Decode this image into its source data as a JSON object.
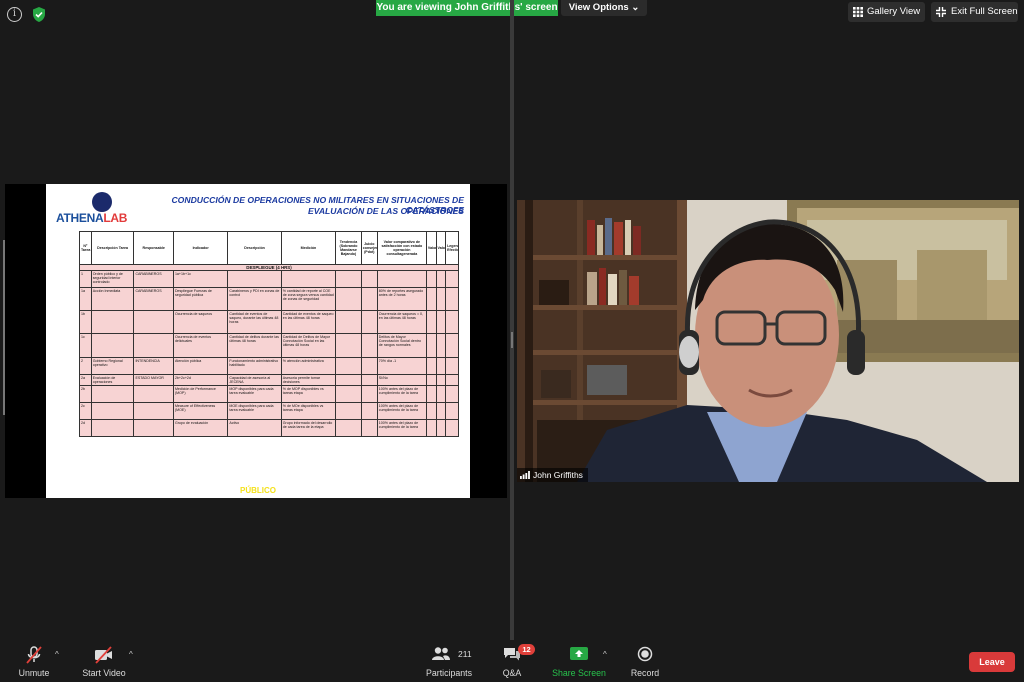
{
  "top_bar": {
    "info_icon": "info-icon",
    "security_icon": "shield-check-icon",
    "viewing_banner": "You are viewing John Griffiths' screen",
    "view_options": "View Options",
    "gallery_view": "Gallery View",
    "exit_full_screen": "Exit Full Screen"
  },
  "slide": {
    "logo_text_a": "ATHENA",
    "logo_text_b": "LAB",
    "title_line1": "CONDUCCIÓN DE OPERACIONES NO MILITARES EN SITUACIONES DE CATÁSTROFE",
    "title_line2": "EVALUACIÓN DE LAS OPERACIONES",
    "footer": "PÚBLICO",
    "headers": [
      "Nº Tarea",
      "Descripción Tarea",
      "Responsable",
      "Indicador",
      "Descripción",
      "Medición",
      "Tendencia (Sobrando Mandarse Bajando)",
      "Juicio consejero (Pdot)",
      "Valor comparativo de satisfacción con estado operación consultagenerada",
      "Valor(1..5)",
      "Valor(1..5)",
      "Legenda Efectivo"
    ],
    "section_label": "DESPLIEGUE (4 HRS)",
    "rows": [
      {
        "cls": "r-md",
        "cells": [
          "1",
          "Orden público y de seguridad interior controlado",
          "CARABINEROS",
          "1a+1b+1c",
          "",
          "",
          "",
          "",
          "",
          "",
          "",
          ""
        ]
      },
      {
        "cls": "r-hi",
        "cells": [
          "1a",
          "Acción Inmediata",
          "CARABINEROS",
          "Despliegue Fuerzas de seguridad pública",
          "Carabineros y PDI en zonas de control",
          "% cantidad de reporte al COE de zona segura versus cantidad de zonas de seguridad",
          "",
          "",
          "80% de reportes asegurado antes de 2 horas",
          "",
          "",
          ""
        ]
      },
      {
        "cls": "r-hi",
        "cells": [
          "1b",
          "",
          "",
          "Ocurrencia de saqueos",
          "Cantidad de eventos de saqueo, durante las últimas 48 horas",
          "Cantidad de eventos de saqueo en las últimas 48 horas",
          "",
          "",
          "Ocurrencia de saqueos = 0, en las últimas 48 horas",
          "",
          "",
          ""
        ]
      },
      {
        "cls": "r-lg",
        "cells": [
          "1c",
          "",
          "",
          "Ocurrencia de eventos delictuales",
          "Cantidad de delitos durante las últimas 48 horas",
          "Cantidad de Delitos de Mayor Connotación Social en las últimas 48 horas",
          "",
          "",
          "Delitos de Mayor Connotación Social dentro de rangos normales",
          "",
          "",
          ""
        ]
      },
      {
        "cls": "r-md",
        "cells": [
          "2",
          "Gobierno Regional operativo",
          "INTENDENCIA",
          "Atención pública",
          "Funcionamiento administrativo habilitado",
          "% atención administrativa",
          "",
          "",
          "70% día -1",
          "",
          "",
          ""
        ]
      },
      {
        "cls": "r-sm",
        "cells": [
          "2a",
          "Evaluación de operaciones",
          "ESTADO MAYOR",
          "2b+2c+2d",
          "Capacidad de asesoría al JECENA",
          "Asesoría permite tomar decisiones",
          "",
          "",
          "SI/No",
          "",
          "",
          ""
        ]
      },
      {
        "cls": "r-md",
        "cells": [
          "2b",
          "",
          "",
          "Medición de Performance (MOP)",
          "MOP disponibles para cada tarea evaluable",
          "% de MOP disponibles vs tareas etapa",
          "",
          "",
          "100% antes del plazo de cumplimiento de la tarea",
          "",
          "",
          ""
        ]
      },
      {
        "cls": "r-md",
        "cells": [
          "2c",
          "",
          "",
          "Measure of Effectiveness (MOE)",
          "MOE disponibles para cada tarea evaluable",
          "% de MOe disponibles vs tareas etapa",
          "",
          "",
          "100% antes del plazo de cumplimiento de la tarea",
          "",
          "",
          ""
        ]
      },
      {
        "cls": "r-md",
        "cells": [
          "2d",
          "",
          "",
          "Grupo de evaluación",
          "Activo",
          "Grupo informado del desarrollo de cada tarea de la etapa",
          "",
          "",
          "100% antes del plazo de cumplimiento de la tarea",
          "",
          "",
          ""
        ]
      }
    ]
  },
  "participant": {
    "name": "John Griffiths"
  },
  "toolbar": {
    "unmute": "Unmute",
    "start_video": "Start Video",
    "participants": "Participants",
    "participants_count": "211",
    "qa": "Q&A",
    "qa_badge": "12",
    "share_screen": "Share Screen",
    "record": "Record",
    "leave": "Leave"
  },
  "colors": {
    "accent_green": "#27a844",
    "leave_red": "#d93a3a",
    "table_pink": "#f7d3d3",
    "slide_title_blue": "#1b3aa0"
  }
}
